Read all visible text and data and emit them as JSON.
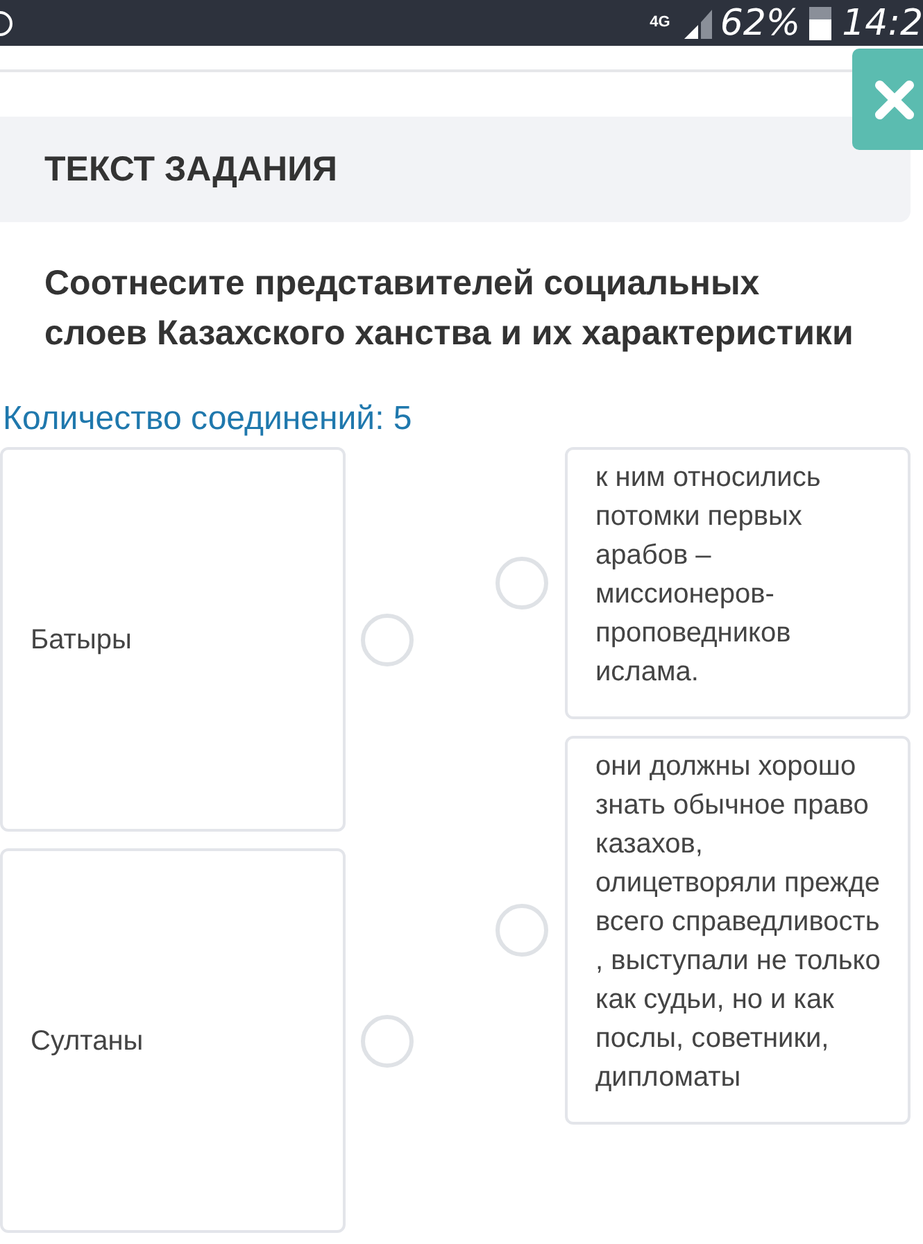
{
  "status_bar": {
    "network": "4G",
    "battery": "62%",
    "time": "14:2"
  },
  "task_header": {
    "title": "ТЕКСТ ЗАДАНИЯ"
  },
  "question": "Соотнесите представителей социальных слоев Казахского ханства и их характеристики",
  "connections_label": "Количество соединений: 5",
  "left_items": [
    {
      "text": "Батыры"
    },
    {
      "text": "Султаны"
    }
  ],
  "right_items": [
    {
      "text": "к ним относились потомки первых арабов – миссионеров-проповедников ислама."
    },
    {
      "text": "они должны хорошо знать обычное право казахов, олицетворяли прежде всего справедливость , выступали не только как судьи, но и как послы, советники, дипломаты"
    }
  ]
}
